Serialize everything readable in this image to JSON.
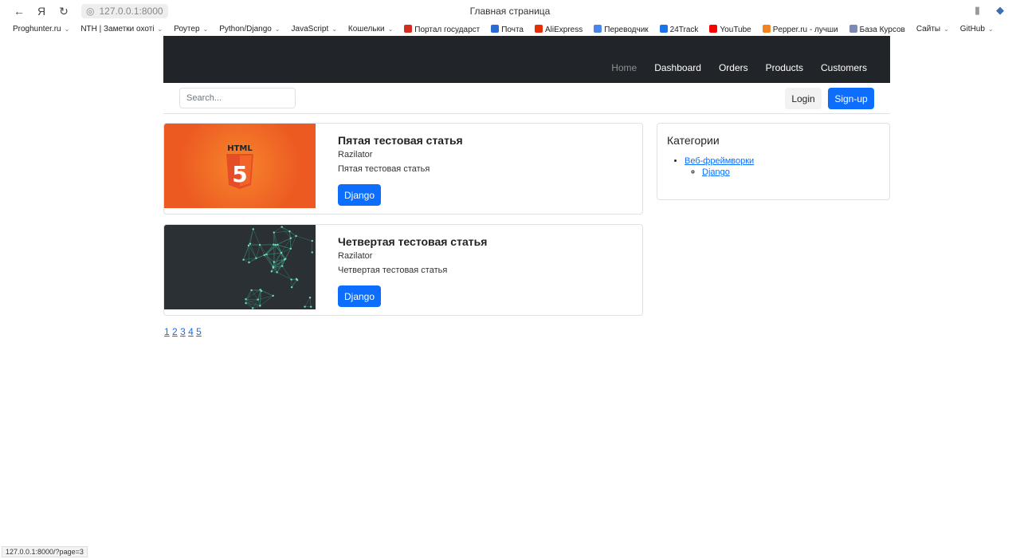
{
  "browser": {
    "url": "127.0.0.1:8000",
    "title": "Главная страница",
    "status_url": "127.0.0.1:8000/?page=3",
    "bookmarks": [
      {
        "label": "Proghunter.ru",
        "folder": true
      },
      {
        "label": "NTH | Заметки охоті",
        "folder": true
      },
      {
        "label": "Роутер",
        "folder": true
      },
      {
        "label": "Python/Django",
        "folder": true
      },
      {
        "label": "JavaScript",
        "folder": true
      },
      {
        "label": "Кошельки",
        "folder": true
      },
      {
        "label": "Портал государст",
        "color": "#d52b1e"
      },
      {
        "label": "Почта",
        "color": "#2b6cd4"
      },
      {
        "label": "AliExpress",
        "color": "#e62e04"
      },
      {
        "label": "Переводчик",
        "color": "#4a86e8"
      },
      {
        "label": "24Track",
        "color": "#1a73e8"
      },
      {
        "label": "YouTube",
        "color": "#ff0000"
      },
      {
        "label": "Pepper.ru - лучши",
        "color": "#f58220"
      },
      {
        "label": "База Курсов",
        "color": "#7b8bb5"
      },
      {
        "label": "Сайты",
        "folder": true
      },
      {
        "label": "GitHub",
        "folder": true
      }
    ]
  },
  "navbar": {
    "items": [
      "Home",
      "Dashboard",
      "Orders",
      "Products",
      "Customers"
    ],
    "active": "Home"
  },
  "search": {
    "placeholder": "Search...",
    "value": ""
  },
  "auth": {
    "login": "Login",
    "signup": "Sign-up"
  },
  "articles": [
    {
      "title": "Пятая тестовая статья",
      "author": "Razilator",
      "description": "Пятая тестовая статья",
      "tag": "Django",
      "image": "html5-logo"
    },
    {
      "title": "Четвертая тестовая статья",
      "author": "Razilator",
      "description": "Четвертая тестовая статья",
      "tag": "Django",
      "image": "network-graph"
    }
  ],
  "pagination": [
    "1",
    "2",
    "3",
    "4",
    "5"
  ],
  "sidebar": {
    "title": "Категории",
    "category": "Веб-фреймворки",
    "subcategory": "Django"
  },
  "colors": {
    "primary": "#0d6efd",
    "navbar": "#212529"
  }
}
